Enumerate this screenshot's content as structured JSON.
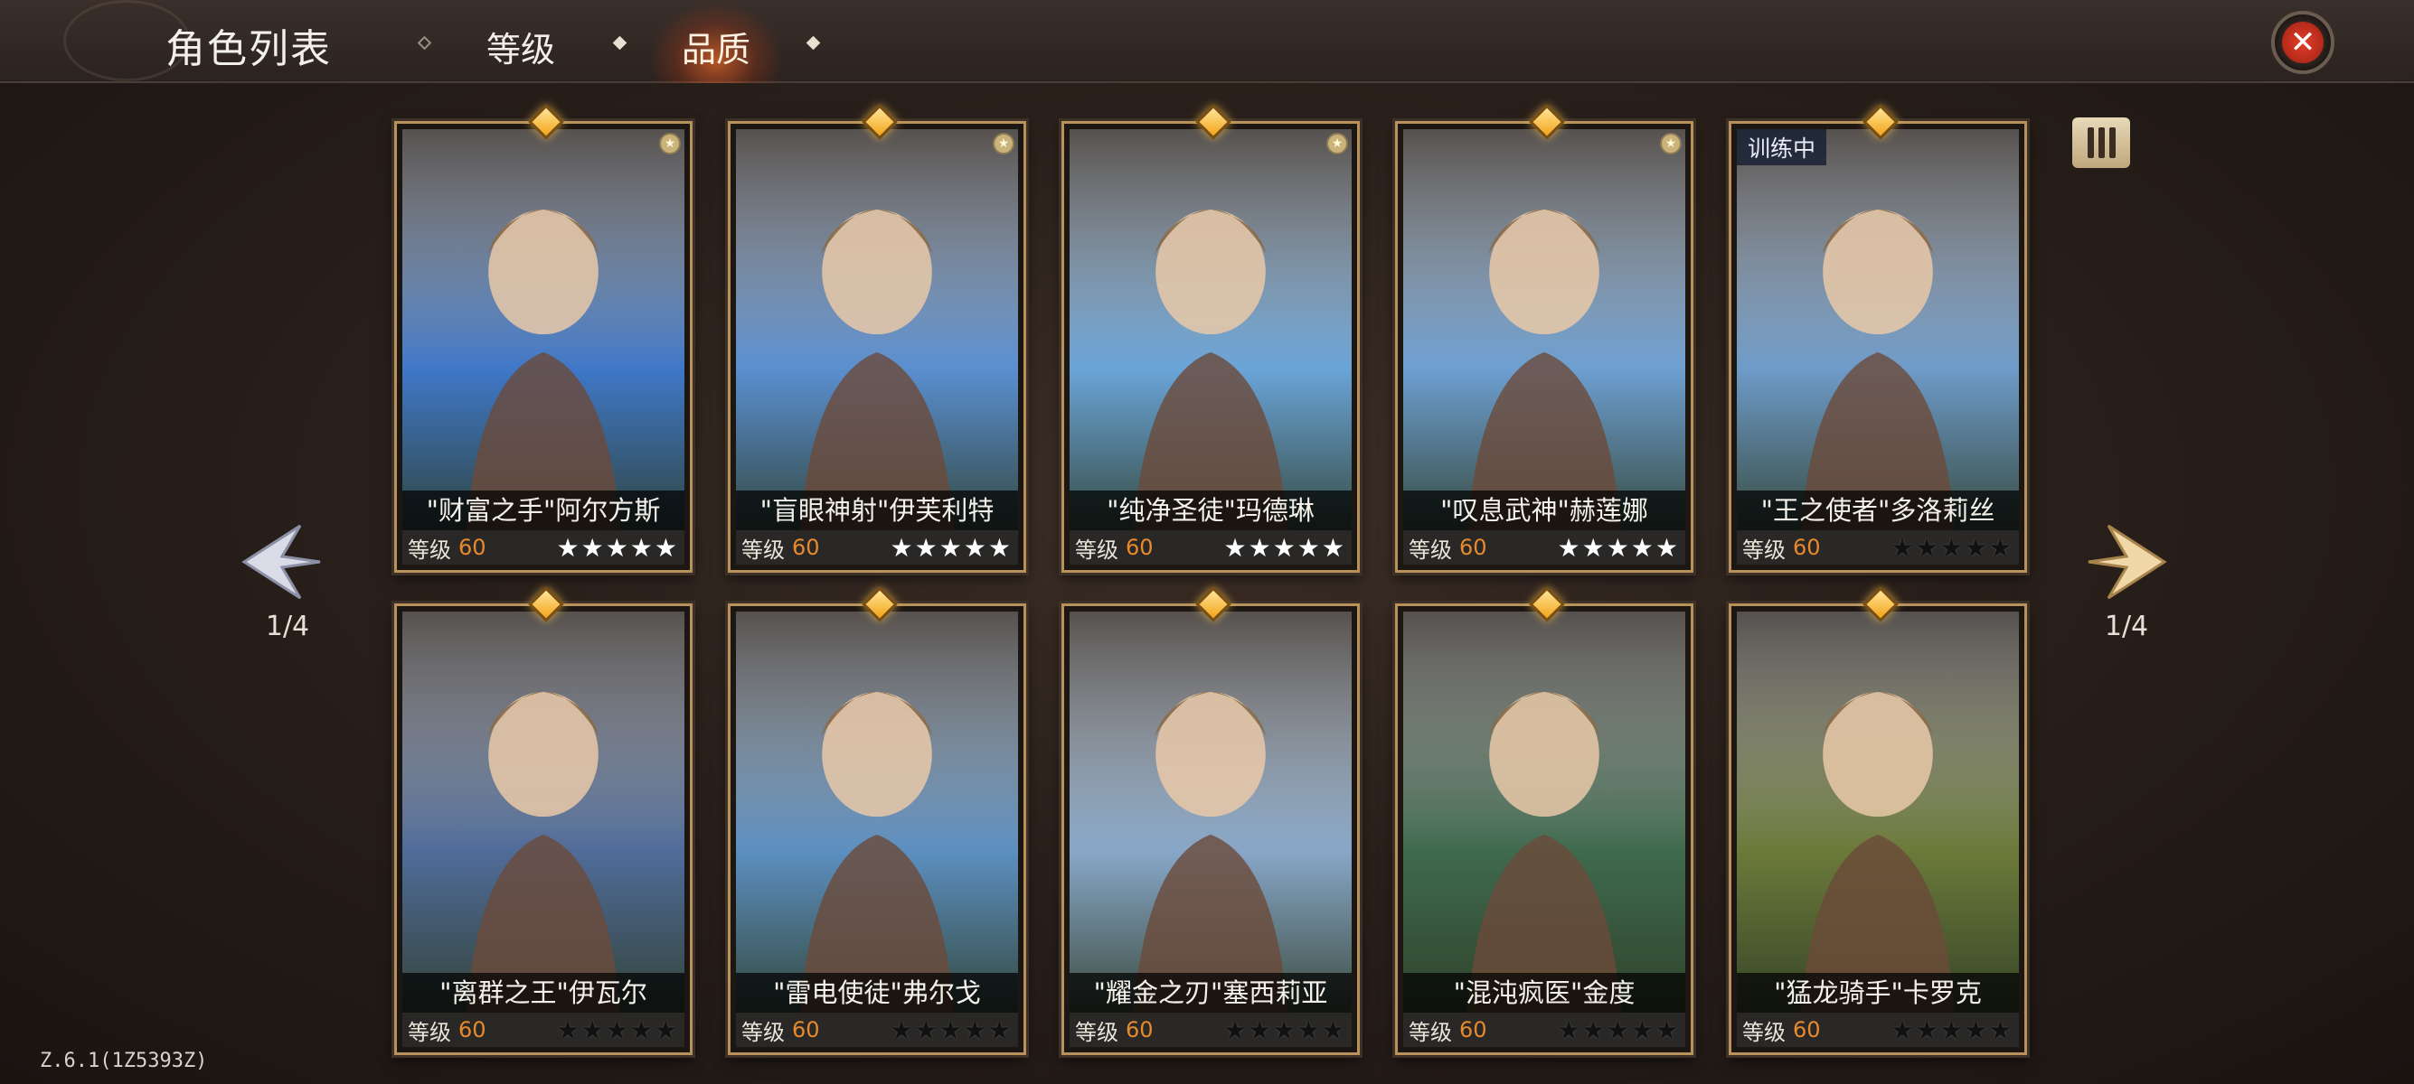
{
  "header": {
    "title": "角色列表",
    "tabs": [
      {
        "label": "等级",
        "active": false
      },
      {
        "label": "品质",
        "active": true
      }
    ],
    "close_icon": "close-icon"
  },
  "nav": {
    "left_page": "1/4",
    "right_page": "1/4"
  },
  "training_badge": "训练中",
  "cards": [
    {
      "name": "\"财富之手\"阿尔方斯",
      "level_label": "等级",
      "level": "60",
      "stars": "★★★★★",
      "stars_style": "full",
      "art": "#3f78c8"
    },
    {
      "name": "\"盲眼神射\"伊芙利特",
      "level_label": "等级",
      "level": "60",
      "stars": "★★★★★",
      "stars_style": "full",
      "art": "#5a8fd0"
    },
    {
      "name": "\"纯净圣徒\"玛德琳",
      "level_label": "等级",
      "level": "60",
      "stars": "★★★★★",
      "stars_style": "full",
      "art": "#6aa4d8"
    },
    {
      "name": "\"叹息武神\"赫莲娜",
      "level_label": "等级",
      "level": "60",
      "stars": "★★★★★",
      "stars_style": "full",
      "art": "#6d9fd1"
    },
    {
      "name": "\"王之使者\"多洛莉丝",
      "level_label": "等级",
      "level": "60",
      "stars": "★★★★★",
      "stars_style": "empty",
      "art": "#6e9bc9"
    },
    {
      "name": "\"离群之王\"伊瓦尔",
      "level_label": "等级",
      "level": "60",
      "stars": "★★★★★",
      "stars_style": "empty",
      "art": "#506c9a"
    },
    {
      "name": "\"雷电使徒\"弗尔戈",
      "level_label": "等级",
      "level": "60",
      "stars": "★★★★★",
      "stars_style": "empty",
      "art": "#5c8fc0"
    },
    {
      "name": "\"耀金之刃\"塞西莉亚",
      "level_label": "等级",
      "level": "60",
      "stars": "★★★★★",
      "stars_style": "empty",
      "art": "#88a7c8"
    },
    {
      "name": "\"混沌疯医\"金度",
      "level_label": "等级",
      "level": "60",
      "stars": "★★★★★",
      "stars_style": "empty",
      "art": "#3f6a4e"
    },
    {
      "name": "\"猛龙骑手\"卡罗克",
      "level_label": "等级",
      "level": "60",
      "stars": "★★★★★",
      "stars_style": "empty",
      "art": "#6b7a3a"
    }
  ],
  "version": "Z.6.1(1Z5393Z)"
}
